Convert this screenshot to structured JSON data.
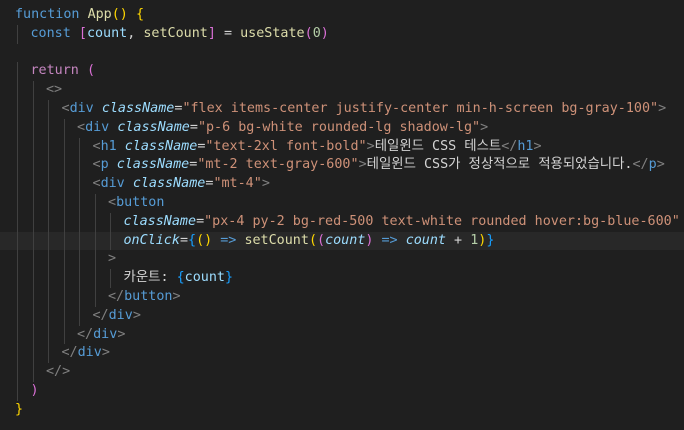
{
  "colors": {
    "background": "#1f1f1f",
    "current_line": "#282828",
    "keyword": "#c586c0",
    "storage": "#569cd6",
    "function": "#dcdcaa",
    "variable": "#9cdcfe",
    "string": "#ce9178",
    "tag": "#569cd6",
    "bracket_gold": "#ffd700",
    "bracket_purple": "#da70d6",
    "bracket_blue": "#179fff"
  },
  "editor": {
    "current_line_index": 12,
    "lines": [
      {
        "indent": 0,
        "tokens": [
          {
            "t": "function ",
            "c": "storage"
          },
          {
            "t": "App",
            "c": "function"
          },
          {
            "t": "() ",
            "c": "bracket1"
          },
          {
            "t": "{",
            "c": "bracket1"
          }
        ]
      },
      {
        "indent": 1,
        "tokens": [
          {
            "t": "const ",
            "c": "storage"
          },
          {
            "t": "[",
            "c": "bracket2"
          },
          {
            "t": "count",
            "c": "variable"
          },
          {
            "t": ", ",
            "c": "plain"
          },
          {
            "t": "setCount",
            "c": "function"
          },
          {
            "t": "]",
            "c": "bracket2"
          },
          {
            "t": " = ",
            "c": "op"
          },
          {
            "t": "useState",
            "c": "function"
          },
          {
            "t": "(",
            "c": "bracket2"
          },
          {
            "t": "0",
            "c": "number"
          },
          {
            "t": ")",
            "c": "bracket2"
          }
        ]
      },
      {
        "indent": 0,
        "tokens": []
      },
      {
        "indent": 1,
        "tokens": [
          {
            "t": "return ",
            "c": "keyword"
          },
          {
            "t": "(",
            "c": "bracket2"
          }
        ]
      },
      {
        "indent": 2,
        "tokens": [
          {
            "t": "<>",
            "c": "punct"
          }
        ]
      },
      {
        "indent": 3,
        "tokens": [
          {
            "t": "<",
            "c": "punct"
          },
          {
            "t": "div",
            "c": "tag"
          },
          {
            "t": " ",
            "c": "plain"
          },
          {
            "t": "className",
            "c": "attr"
          },
          {
            "t": "=",
            "c": "op"
          },
          {
            "t": "\"flex items-center justify-center min-h-screen bg-gray-100\"",
            "c": "string"
          },
          {
            "t": ">",
            "c": "punct"
          }
        ]
      },
      {
        "indent": 4,
        "tokens": [
          {
            "t": "<",
            "c": "punct"
          },
          {
            "t": "div",
            "c": "tag"
          },
          {
            "t": " ",
            "c": "plain"
          },
          {
            "t": "className",
            "c": "attr"
          },
          {
            "t": "=",
            "c": "op"
          },
          {
            "t": "\"p-6 bg-white rounded-lg shadow-lg\"",
            "c": "string"
          },
          {
            "t": ">",
            "c": "punct"
          }
        ]
      },
      {
        "indent": 5,
        "tokens": [
          {
            "t": "<",
            "c": "punct"
          },
          {
            "t": "h1",
            "c": "tag"
          },
          {
            "t": " ",
            "c": "plain"
          },
          {
            "t": "className",
            "c": "attr"
          },
          {
            "t": "=",
            "c": "op"
          },
          {
            "t": "\"text-2xl font-bold\"",
            "c": "string"
          },
          {
            "t": ">",
            "c": "punct"
          },
          {
            "t": "테일윈드 CSS 테스트",
            "c": "text"
          },
          {
            "t": "</",
            "c": "punct"
          },
          {
            "t": "h1",
            "c": "tag"
          },
          {
            "t": ">",
            "c": "punct"
          }
        ]
      },
      {
        "indent": 5,
        "tokens": [
          {
            "t": "<",
            "c": "punct"
          },
          {
            "t": "p",
            "c": "tag"
          },
          {
            "t": " ",
            "c": "plain"
          },
          {
            "t": "className",
            "c": "attr"
          },
          {
            "t": "=",
            "c": "op"
          },
          {
            "t": "\"mt-2 text-gray-600\"",
            "c": "string"
          },
          {
            "t": ">",
            "c": "punct"
          },
          {
            "t": "테일윈드 CSS가 정상적으로 적용되었습니다.",
            "c": "text"
          },
          {
            "t": "</",
            "c": "punct"
          },
          {
            "t": "p",
            "c": "tag"
          },
          {
            "t": ">",
            "c": "punct"
          }
        ]
      },
      {
        "indent": 5,
        "tokens": [
          {
            "t": "<",
            "c": "punct"
          },
          {
            "t": "div",
            "c": "tag"
          },
          {
            "t": " ",
            "c": "plain"
          },
          {
            "t": "className",
            "c": "attr"
          },
          {
            "t": "=",
            "c": "op"
          },
          {
            "t": "\"mt-4\"",
            "c": "string"
          },
          {
            "t": ">",
            "c": "punct"
          }
        ]
      },
      {
        "indent": 6,
        "tokens": [
          {
            "t": "<",
            "c": "punct"
          },
          {
            "t": "button",
            "c": "tag"
          }
        ]
      },
      {
        "indent": 7,
        "tokens": [
          {
            "t": "className",
            "c": "attr"
          },
          {
            "t": "=",
            "c": "op"
          },
          {
            "t": "\"px-4 py-2 bg-red-500 text-white rounded hover:bg-blue-600\"",
            "c": "string"
          }
        ]
      },
      {
        "indent": 7,
        "tokens": [
          {
            "t": "onClick",
            "c": "attr"
          },
          {
            "t": "=",
            "c": "op"
          },
          {
            "t": "{",
            "c": "bracket3"
          },
          {
            "t": "()",
            "c": "bracket1"
          },
          {
            "t": " => ",
            "c": "storage"
          },
          {
            "t": "setCount",
            "c": "function"
          },
          {
            "t": "(",
            "c": "bracket1"
          },
          {
            "t": "(",
            "c": "bracket2"
          },
          {
            "t": "count",
            "c": "param"
          },
          {
            "t": ")",
            "c": "bracket2"
          },
          {
            "t": " => ",
            "c": "storage"
          },
          {
            "t": "count",
            "c": "param"
          },
          {
            "t": " + ",
            "c": "op"
          },
          {
            "t": "1",
            "c": "number"
          },
          {
            "t": ")",
            "c": "bracket1"
          },
          {
            "t": "}",
            "c": "bracket3"
          }
        ]
      },
      {
        "indent": 6,
        "tokens": [
          {
            "t": ">",
            "c": "punct"
          }
        ]
      },
      {
        "indent": 7,
        "tokens": [
          {
            "t": "카운트: ",
            "c": "text"
          },
          {
            "t": "{",
            "c": "bracket3"
          },
          {
            "t": "count",
            "c": "variable"
          },
          {
            "t": "}",
            "c": "bracket3"
          }
        ]
      },
      {
        "indent": 6,
        "tokens": [
          {
            "t": "</",
            "c": "punct"
          },
          {
            "t": "button",
            "c": "tag"
          },
          {
            "t": ">",
            "c": "punct"
          }
        ]
      },
      {
        "indent": 5,
        "tokens": [
          {
            "t": "</",
            "c": "punct"
          },
          {
            "t": "div",
            "c": "tag"
          },
          {
            "t": ">",
            "c": "punct"
          }
        ]
      },
      {
        "indent": 4,
        "tokens": [
          {
            "t": "</",
            "c": "punct"
          },
          {
            "t": "div",
            "c": "tag"
          },
          {
            "t": ">",
            "c": "punct"
          }
        ]
      },
      {
        "indent": 3,
        "tokens": [
          {
            "t": "</",
            "c": "punct"
          },
          {
            "t": "div",
            "c": "tag"
          },
          {
            "t": ">",
            "c": "punct"
          }
        ]
      },
      {
        "indent": 2,
        "tokens": [
          {
            "t": "</>",
            "c": "punct"
          }
        ]
      },
      {
        "indent": 1,
        "tokens": [
          {
            "t": ")",
            "c": "bracket2"
          }
        ]
      },
      {
        "indent": 0,
        "tokens": [
          {
            "t": "}",
            "c": "bracket1"
          }
        ]
      }
    ]
  }
}
